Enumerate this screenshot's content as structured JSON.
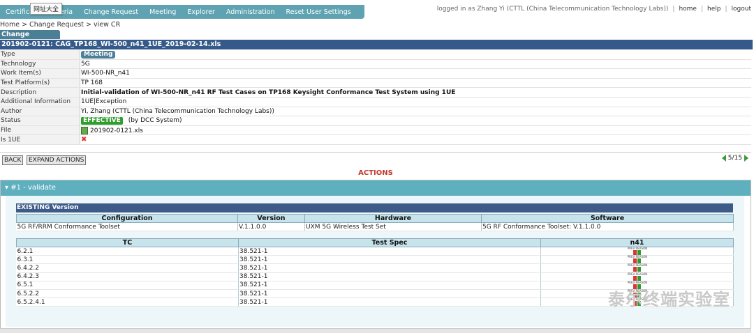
{
  "nav": {
    "tabs": [
      "Certification Criteria",
      "Change Request",
      "Meeting",
      "Explorer",
      "Administration",
      "Reset User Settings"
    ],
    "tooltip": "网址大全",
    "user": "logged in as Zhang Yi (CTTL (China Telecommunication Technology Labs))",
    "links": [
      "home",
      "help",
      "logout"
    ]
  },
  "breadcrumb": "Home > Change Request > view CR",
  "section_tab": "Change Request",
  "record_title": "201902-0121: CAG_TP168_WI-500_n41_1UE_2019-02-14.xls",
  "details": {
    "type_label": "Type",
    "type_value": "Meeting",
    "technology_label": "Technology",
    "technology_value": "5G",
    "work_items_label": "Work Item(s)",
    "work_items_value": "WI-500-NR_n41",
    "platforms_label": "Test Platform(s)",
    "platforms_value": "TP 168",
    "description_label": "Description",
    "description_value": "Initial-validation of WI-500-NR_n41 RF Test Cases on TP168 Keysight Conformance Test System using 1UE",
    "additional_label": "Additional Information",
    "additional_value": "1UE|Exception",
    "author_label": "Author",
    "author_value": "Yi, Zhang (CTTL (China Telecommunication Technology Labs))",
    "status_label": "Status",
    "status_value": "EFFECTIVE",
    "status_by": "(by DCC System)",
    "file_label": "File",
    "file_value": "201902-0121.xls",
    "is1ue_label": "Is 1UE",
    "is1ue_value": "✖"
  },
  "actions": {
    "back_label": "BACK",
    "expand_label": "EXPAND ACTIONS",
    "pager": "5/15",
    "title": "ACTIONS",
    "item_title": "▾ #1 - validate",
    "existing_header": "EXISTING Version"
  },
  "config_table": {
    "headers": [
      "Configuration",
      "Version",
      "Hardware",
      "Software"
    ],
    "row": [
      "5G RF/RRM Conformance Toolset",
      "V.1.1.0.0",
      "UXM 5G Wireless Test Set",
      "5G RF Conformance Toolset: V.1.1.0.0"
    ]
  },
  "tc_table": {
    "headers": [
      "TC",
      "Test Spec",
      "n41"
    ],
    "status_top": "PREV REASON",
    "rows": [
      {
        "tc": "6.2.1",
        "spec": "38.521-1"
      },
      {
        "tc": "6.3.1",
        "spec": "38.521-1"
      },
      {
        "tc": "6.4.2.2",
        "spec": "38.521-1"
      },
      {
        "tc": "6.4.2.3",
        "spec": "38.521-1"
      },
      {
        "tc": "6.5.1",
        "spec": "38.521-1"
      },
      {
        "tc": "6.5.2.2",
        "spec": "38.521-1"
      },
      {
        "tc": "6.5.2.4.1",
        "spec": "38.521-1"
      }
    ]
  },
  "watermark": "泰尔终端实验室",
  "colors": {
    "nav": "#5fa3b3",
    "title_bar": "#355a8a",
    "actions_red": "#c0392b",
    "effective_green": "#2f9e2f"
  }
}
